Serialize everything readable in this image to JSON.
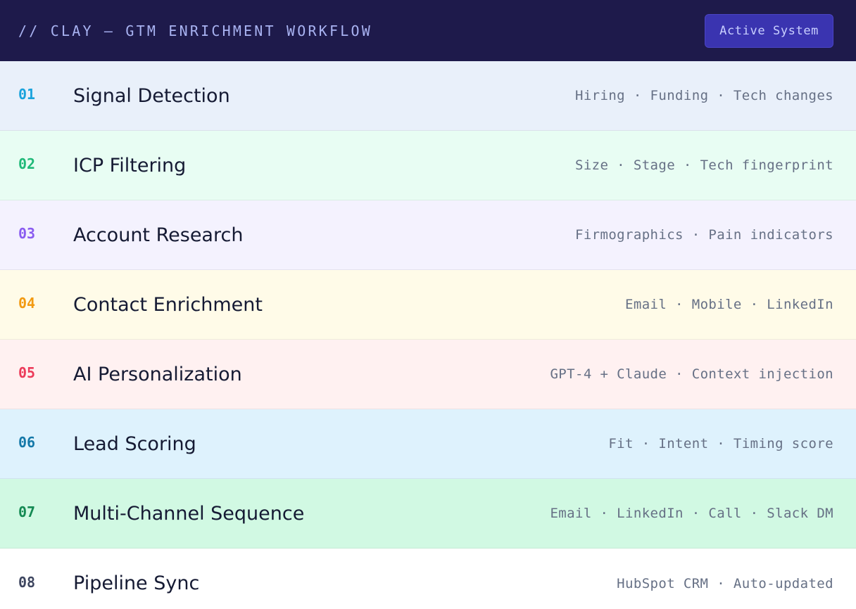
{
  "header": {
    "title": "// CLAY — GTM ENRICHMENT WORKFLOW",
    "badge": "Active System"
  },
  "rows": [
    {
      "num": "01",
      "label": "Signal Detection",
      "tags": "Hiring · Funding · Tech changes",
      "bg": "#e9f0fa",
      "accent": "#1aa3dc"
    },
    {
      "num": "02",
      "label": "ICP Filtering",
      "tags": "Size · Stage · Tech fingerprint",
      "bg": "#e8fdf3",
      "accent": "#1fb978"
    },
    {
      "num": "03",
      "label": "Account Research",
      "tags": "Firmographics · Pain indicators",
      "bg": "#f4f2fe",
      "accent": "#8a5cf0"
    },
    {
      "num": "04",
      "label": "Contact Enrichment",
      "tags": "Email · Mobile · LinkedIn",
      "bg": "#fffbe8",
      "accent": "#f29a12"
    },
    {
      "num": "05",
      "label": "AI Personalization",
      "tags": "GPT-4 + Claude · Context injection",
      "bg": "#fff1f1",
      "accent": "#ec3b5a"
    },
    {
      "num": "06",
      "label": "Lead Scoring",
      "tags": "Fit · Intent · Timing score",
      "bg": "#def2fd",
      "accent": "#1478a8"
    },
    {
      "num": "07",
      "label": "Multi-Channel Sequence",
      "tags": "Email · LinkedIn · Call · Slack DM",
      "bg": "#d1f9e3",
      "accent": "#148a53"
    },
    {
      "num": "08",
      "label": "Pipeline Sync",
      "tags": "HubSpot CRM · Auto-updated",
      "bg": "#ffffff",
      "accent": "#3e4660"
    }
  ]
}
